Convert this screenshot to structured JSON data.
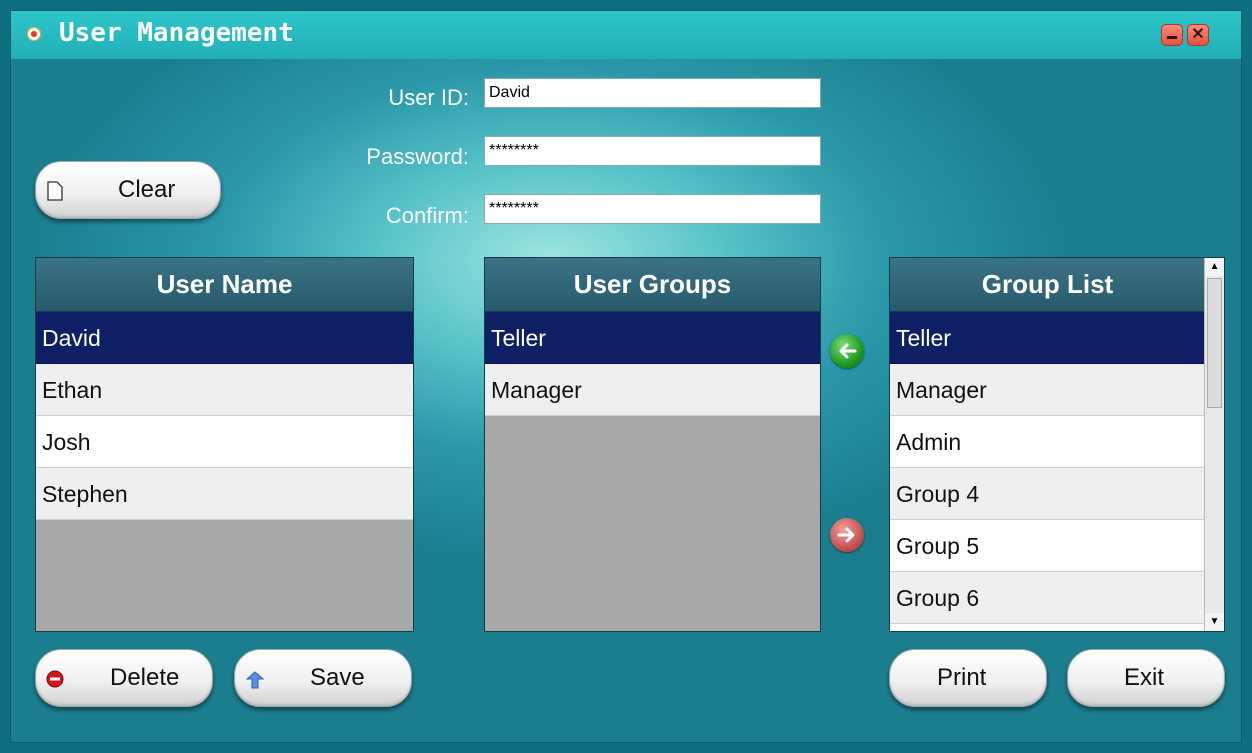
{
  "window": {
    "title": "User Management"
  },
  "form": {
    "user_id_label": "User ID:",
    "user_id_value": "David",
    "password_label": "Password:",
    "password_value": "********",
    "confirm_label": "Confirm:",
    "confirm_value": "********"
  },
  "buttons": {
    "clear": "Clear",
    "delete": "Delete",
    "save": "Save",
    "print": "Print",
    "exit": "Exit"
  },
  "user_names": {
    "header": "User Name",
    "items": [
      "David",
      "Ethan",
      "Josh",
      "Stephen"
    ],
    "selected": "David"
  },
  "user_groups": {
    "header": "User Groups",
    "items": [
      "Teller",
      "Manager"
    ],
    "selected": "Teller"
  },
  "group_list": {
    "header": "Group List",
    "items": [
      "Teller",
      "Manager",
      "Admin",
      "Group 4",
      "Group 5",
      "Group 6"
    ],
    "selected": "Teller"
  },
  "icons": {
    "title": "app-dot-icon",
    "minimize": "minimize-icon",
    "close": "close-icon",
    "clear": "document-icon",
    "delete": "delete-icon",
    "save": "save-arrow-icon",
    "add_group": "arrow-left-icon",
    "remove_group": "arrow-right-icon"
  },
  "colors": {
    "selection": "#0f1f66",
    "header": "#285a6b",
    "add_arrow": "#1f9a1f",
    "remove_arrow": "#c65454"
  }
}
